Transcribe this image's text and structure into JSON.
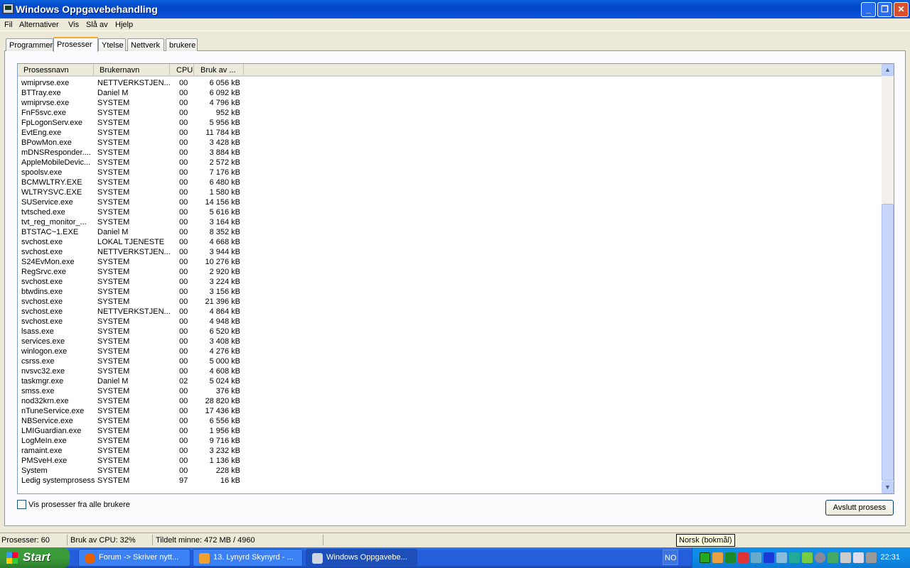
{
  "window": {
    "title": "Windows Oppgavebehandling"
  },
  "menu": [
    "Fil",
    "Alternativer",
    "Vis",
    "Slå av",
    "Hjelp"
  ],
  "tabs": [
    "Programmer",
    "Prosesser",
    "Ytelse",
    "Nettverk",
    "brukere"
  ],
  "columns": [
    "Prosessnavn",
    "Brukernavn",
    "CPU",
    "Bruk av ..."
  ],
  "processes": [
    [
      "wmiprvse.exe",
      "NETTVERKSTJEN...",
      "00",
      "6 056 kB"
    ],
    [
      "BTTray.exe",
      "Daniel M",
      "00",
      "6 092 kB"
    ],
    [
      "wmiprvse.exe",
      "SYSTEM",
      "00",
      "4 796 kB"
    ],
    [
      "FnF5svc.exe",
      "SYSTEM",
      "00",
      "952 kB"
    ],
    [
      "FpLogonServ.exe",
      "SYSTEM",
      "00",
      "5 956 kB"
    ],
    [
      "EvtEng.exe",
      "SYSTEM",
      "00",
      "11 784 kB"
    ],
    [
      "BPowMon.exe",
      "SYSTEM",
      "00",
      "3 428 kB"
    ],
    [
      "mDNSResponder....",
      "SYSTEM",
      "00",
      "3 884 kB"
    ],
    [
      "AppleMobileDevic...",
      "SYSTEM",
      "00",
      "2 572 kB"
    ],
    [
      "spoolsv.exe",
      "SYSTEM",
      "00",
      "7 176 kB"
    ],
    [
      "BCMWLTRY.EXE",
      "SYSTEM",
      "00",
      "6 480 kB"
    ],
    [
      "WLTRYSVC.EXE",
      "SYSTEM",
      "00",
      "1 580 kB"
    ],
    [
      "SUService.exe",
      "SYSTEM",
      "00",
      "14 156 kB"
    ],
    [
      "tvtsched.exe",
      "SYSTEM",
      "00",
      "5 616 kB"
    ],
    [
      "tvt_reg_monitor_...",
      "SYSTEM",
      "00",
      "3 164 kB"
    ],
    [
      "BTSTAC~1.EXE",
      "Daniel M",
      "00",
      "8 352 kB"
    ],
    [
      "svchost.exe",
      "LOKAL TJENESTE",
      "00",
      "4 668 kB"
    ],
    [
      "svchost.exe",
      "NETTVERKSTJEN...",
      "00",
      "3 944 kB"
    ],
    [
      "S24EvMon.exe",
      "SYSTEM",
      "00",
      "10 276 kB"
    ],
    [
      "RegSrvc.exe",
      "SYSTEM",
      "00",
      "2 920 kB"
    ],
    [
      "svchost.exe",
      "SYSTEM",
      "00",
      "3 224 kB"
    ],
    [
      "btwdins.exe",
      "SYSTEM",
      "00",
      "3 156 kB"
    ],
    [
      "svchost.exe",
      "SYSTEM",
      "00",
      "21 396 kB"
    ],
    [
      "svchost.exe",
      "NETTVERKSTJEN...",
      "00",
      "4 864 kB"
    ],
    [
      "svchost.exe",
      "SYSTEM",
      "00",
      "4 948 kB"
    ],
    [
      "lsass.exe",
      "SYSTEM",
      "00",
      "6 520 kB"
    ],
    [
      "services.exe",
      "SYSTEM",
      "00",
      "3 408 kB"
    ],
    [
      "winlogon.exe",
      "SYSTEM",
      "00",
      "4 276 kB"
    ],
    [
      "csrss.exe",
      "SYSTEM",
      "00",
      "5 000 kB"
    ],
    [
      "nvsvc32.exe",
      "SYSTEM",
      "00",
      "4 608 kB"
    ],
    [
      "taskmgr.exe",
      "Daniel M",
      "02",
      "5 024 kB"
    ],
    [
      "smss.exe",
      "SYSTEM",
      "00",
      "376 kB"
    ],
    [
      "nod32krn.exe",
      "SYSTEM",
      "00",
      "28 820 kB"
    ],
    [
      "nTuneService.exe",
      "SYSTEM",
      "00",
      "17 436 kB"
    ],
    [
      "NBService.exe",
      "SYSTEM",
      "00",
      "6 556 kB"
    ],
    [
      "LMIGuardian.exe",
      "SYSTEM",
      "00",
      "1 956 kB"
    ],
    [
      "LogMeIn.exe",
      "SYSTEM",
      "00",
      "9 716 kB"
    ],
    [
      "ramaint.exe",
      "SYSTEM",
      "00",
      "3 232 kB"
    ],
    [
      "PMSveH.exe",
      "SYSTEM",
      "00",
      "1 136 kB"
    ],
    [
      "System",
      "SYSTEM",
      "00",
      "228 kB"
    ],
    [
      "Ledig systemprosess",
      "SYSTEM",
      "97",
      "16 kB"
    ]
  ],
  "show_all_label": "Vis prosesser fra alle brukere",
  "end_process_label": "Avslutt prosess",
  "status": {
    "processes": "Prosesser: 60",
    "cpu": "Bruk av CPU: 32%",
    "memory": "Tildelt minne: 472 MB / 4960"
  },
  "tooltip": "Norsk (bokmål)",
  "taskbar": {
    "start": "Start",
    "buttons": [
      "Forum -> Skriver nytt...",
      "13. Lynyrd Skynyrd - ...",
      "Windows Oppgavebe..."
    ],
    "lang": "NO",
    "clock": "22:31"
  }
}
